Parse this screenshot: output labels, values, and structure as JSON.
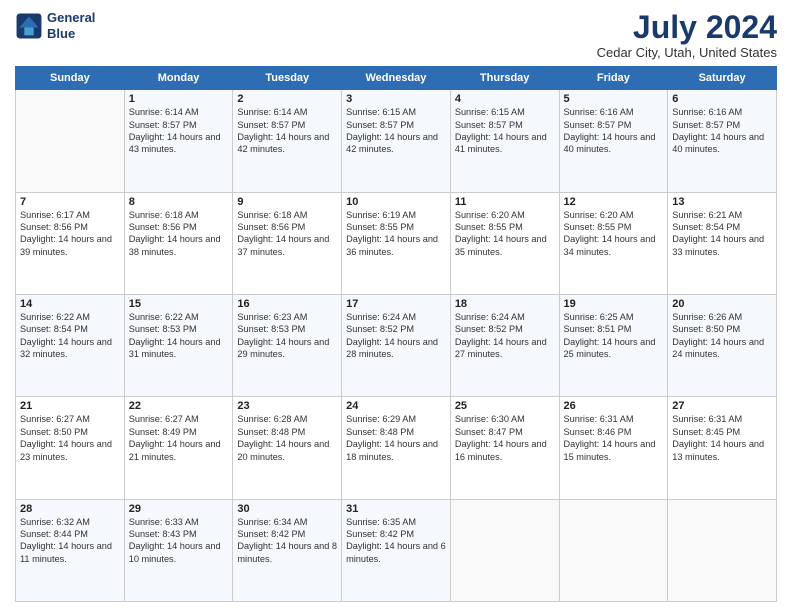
{
  "header": {
    "logo_line1": "General",
    "logo_line2": "Blue",
    "title": "July 2024",
    "subtitle": "Cedar City, Utah, United States"
  },
  "days_of_week": [
    "Sunday",
    "Monday",
    "Tuesday",
    "Wednesday",
    "Thursday",
    "Friday",
    "Saturday"
  ],
  "weeks": [
    [
      {
        "day": "",
        "sunrise": "",
        "sunset": "",
        "daylight": ""
      },
      {
        "day": "1",
        "sunrise": "Sunrise: 6:14 AM",
        "sunset": "Sunset: 8:57 PM",
        "daylight": "Daylight: 14 hours and 43 minutes."
      },
      {
        "day": "2",
        "sunrise": "Sunrise: 6:14 AM",
        "sunset": "Sunset: 8:57 PM",
        "daylight": "Daylight: 14 hours and 42 minutes."
      },
      {
        "day": "3",
        "sunrise": "Sunrise: 6:15 AM",
        "sunset": "Sunset: 8:57 PM",
        "daylight": "Daylight: 14 hours and 42 minutes."
      },
      {
        "day": "4",
        "sunrise": "Sunrise: 6:15 AM",
        "sunset": "Sunset: 8:57 PM",
        "daylight": "Daylight: 14 hours and 41 minutes."
      },
      {
        "day": "5",
        "sunrise": "Sunrise: 6:16 AM",
        "sunset": "Sunset: 8:57 PM",
        "daylight": "Daylight: 14 hours and 40 minutes."
      },
      {
        "day": "6",
        "sunrise": "Sunrise: 6:16 AM",
        "sunset": "Sunset: 8:57 PM",
        "daylight": "Daylight: 14 hours and 40 minutes."
      }
    ],
    [
      {
        "day": "7",
        "sunrise": "Sunrise: 6:17 AM",
        "sunset": "Sunset: 8:56 PM",
        "daylight": "Daylight: 14 hours and 39 minutes."
      },
      {
        "day": "8",
        "sunrise": "Sunrise: 6:18 AM",
        "sunset": "Sunset: 8:56 PM",
        "daylight": "Daylight: 14 hours and 38 minutes."
      },
      {
        "day": "9",
        "sunrise": "Sunrise: 6:18 AM",
        "sunset": "Sunset: 8:56 PM",
        "daylight": "Daylight: 14 hours and 37 minutes."
      },
      {
        "day": "10",
        "sunrise": "Sunrise: 6:19 AM",
        "sunset": "Sunset: 8:55 PM",
        "daylight": "Daylight: 14 hours and 36 minutes."
      },
      {
        "day": "11",
        "sunrise": "Sunrise: 6:20 AM",
        "sunset": "Sunset: 8:55 PM",
        "daylight": "Daylight: 14 hours and 35 minutes."
      },
      {
        "day": "12",
        "sunrise": "Sunrise: 6:20 AM",
        "sunset": "Sunset: 8:55 PM",
        "daylight": "Daylight: 14 hours and 34 minutes."
      },
      {
        "day": "13",
        "sunrise": "Sunrise: 6:21 AM",
        "sunset": "Sunset: 8:54 PM",
        "daylight": "Daylight: 14 hours and 33 minutes."
      }
    ],
    [
      {
        "day": "14",
        "sunrise": "Sunrise: 6:22 AM",
        "sunset": "Sunset: 8:54 PM",
        "daylight": "Daylight: 14 hours and 32 minutes."
      },
      {
        "day": "15",
        "sunrise": "Sunrise: 6:22 AM",
        "sunset": "Sunset: 8:53 PM",
        "daylight": "Daylight: 14 hours and 31 minutes."
      },
      {
        "day": "16",
        "sunrise": "Sunrise: 6:23 AM",
        "sunset": "Sunset: 8:53 PM",
        "daylight": "Daylight: 14 hours and 29 minutes."
      },
      {
        "day": "17",
        "sunrise": "Sunrise: 6:24 AM",
        "sunset": "Sunset: 8:52 PM",
        "daylight": "Daylight: 14 hours and 28 minutes."
      },
      {
        "day": "18",
        "sunrise": "Sunrise: 6:24 AM",
        "sunset": "Sunset: 8:52 PM",
        "daylight": "Daylight: 14 hours and 27 minutes."
      },
      {
        "day": "19",
        "sunrise": "Sunrise: 6:25 AM",
        "sunset": "Sunset: 8:51 PM",
        "daylight": "Daylight: 14 hours and 25 minutes."
      },
      {
        "day": "20",
        "sunrise": "Sunrise: 6:26 AM",
        "sunset": "Sunset: 8:50 PM",
        "daylight": "Daylight: 14 hours and 24 minutes."
      }
    ],
    [
      {
        "day": "21",
        "sunrise": "Sunrise: 6:27 AM",
        "sunset": "Sunset: 8:50 PM",
        "daylight": "Daylight: 14 hours and 23 minutes."
      },
      {
        "day": "22",
        "sunrise": "Sunrise: 6:27 AM",
        "sunset": "Sunset: 8:49 PM",
        "daylight": "Daylight: 14 hours and 21 minutes."
      },
      {
        "day": "23",
        "sunrise": "Sunrise: 6:28 AM",
        "sunset": "Sunset: 8:48 PM",
        "daylight": "Daylight: 14 hours and 20 minutes."
      },
      {
        "day": "24",
        "sunrise": "Sunrise: 6:29 AM",
        "sunset": "Sunset: 8:48 PM",
        "daylight": "Daylight: 14 hours and 18 minutes."
      },
      {
        "day": "25",
        "sunrise": "Sunrise: 6:30 AM",
        "sunset": "Sunset: 8:47 PM",
        "daylight": "Daylight: 14 hours and 16 minutes."
      },
      {
        "day": "26",
        "sunrise": "Sunrise: 6:31 AM",
        "sunset": "Sunset: 8:46 PM",
        "daylight": "Daylight: 14 hours and 15 minutes."
      },
      {
        "day": "27",
        "sunrise": "Sunrise: 6:31 AM",
        "sunset": "Sunset: 8:45 PM",
        "daylight": "Daylight: 14 hours and 13 minutes."
      }
    ],
    [
      {
        "day": "28",
        "sunrise": "Sunrise: 6:32 AM",
        "sunset": "Sunset: 8:44 PM",
        "daylight": "Daylight: 14 hours and 11 minutes."
      },
      {
        "day": "29",
        "sunrise": "Sunrise: 6:33 AM",
        "sunset": "Sunset: 8:43 PM",
        "daylight": "Daylight: 14 hours and 10 minutes."
      },
      {
        "day": "30",
        "sunrise": "Sunrise: 6:34 AM",
        "sunset": "Sunset: 8:42 PM",
        "daylight": "Daylight: 14 hours and 8 minutes."
      },
      {
        "day": "31",
        "sunrise": "Sunrise: 6:35 AM",
        "sunset": "Sunset: 8:42 PM",
        "daylight": "Daylight: 14 hours and 6 minutes."
      },
      {
        "day": "",
        "sunrise": "",
        "sunset": "",
        "daylight": ""
      },
      {
        "day": "",
        "sunrise": "",
        "sunset": "",
        "daylight": ""
      },
      {
        "day": "",
        "sunrise": "",
        "sunset": "",
        "daylight": ""
      }
    ]
  ]
}
